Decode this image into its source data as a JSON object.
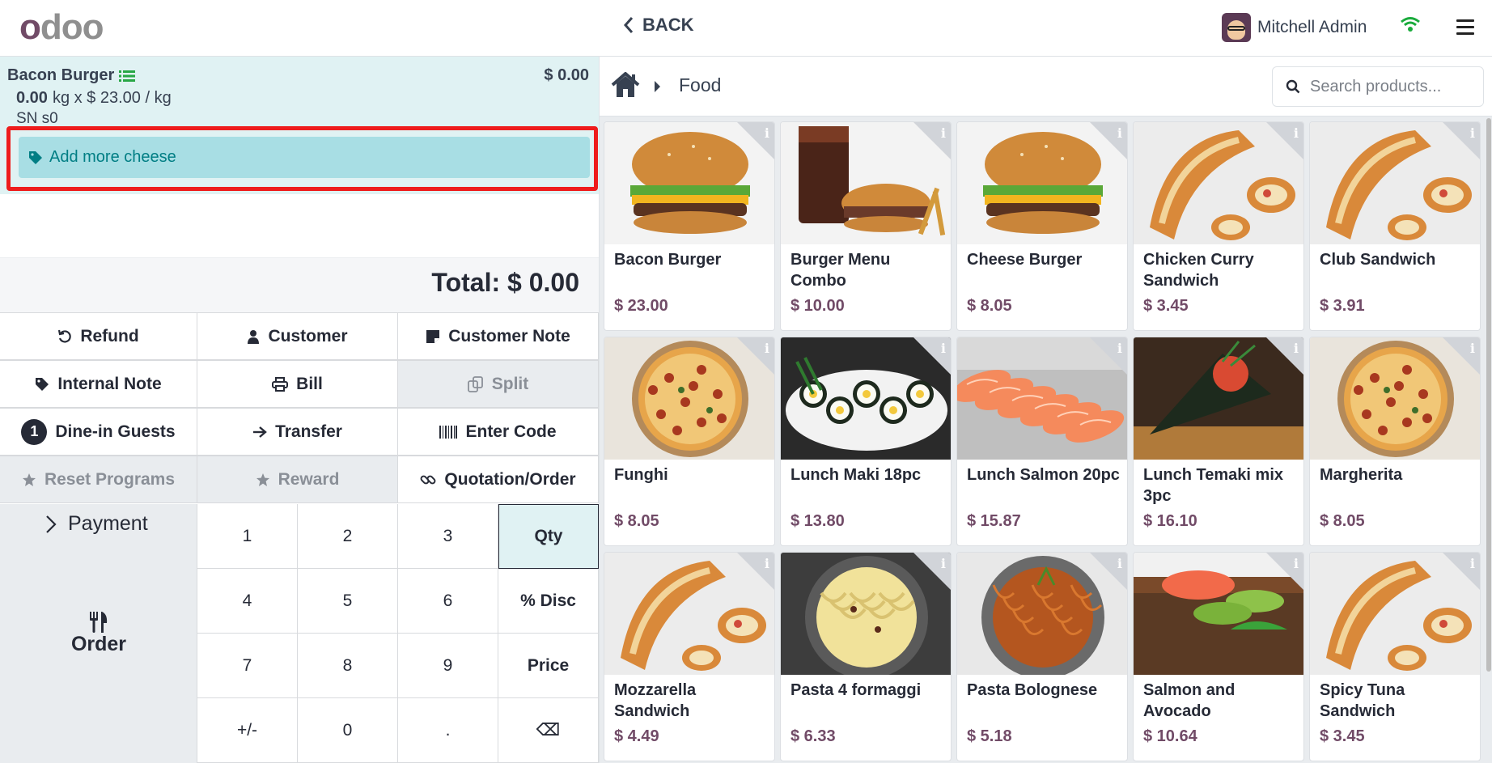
{
  "header": {
    "logo": "odoo",
    "back_label": "BACK",
    "user_name": "Mitchell Admin"
  },
  "order": {
    "line": {
      "product": "Bacon Burger",
      "price": "$ 0.00",
      "qty": "0.00",
      "unit_price": "kg x $ 23.00 / kg",
      "serial": "SN s0",
      "note": "Add more cheese"
    },
    "total": "Total: $ 0.00"
  },
  "controls": {
    "refund": "Refund",
    "customer": "Customer",
    "customer_note": "Customer Note",
    "internal_note": "Internal Note",
    "bill": "Bill",
    "split": "Split",
    "guests_count": "1",
    "dine_in_guests": "Dine-in Guests",
    "transfer": "Transfer",
    "enter_code": "Enter Code",
    "reset_programs": "Reset Programs",
    "reward": "Reward",
    "quotation_order": "Quotation/Order",
    "payment": "Payment",
    "order": "Order"
  },
  "numpad": [
    "1",
    "2",
    "3",
    "Qty",
    "4",
    "5",
    "6",
    "% Disc",
    "7",
    "8",
    "9",
    "Price",
    "+/-",
    "0",
    ".",
    "⌫"
  ],
  "breadcrumb": {
    "category": "Food"
  },
  "search": {
    "placeholder": "Search products..."
  },
  "colors": {
    "brand": "#714b67",
    "selected_line": "#e0f2f3",
    "note_pill": "#a8dee4",
    "highlight_box": "#ee1c1c",
    "wifi": "#1aab3c"
  },
  "products": [
    {
      "name": "Bacon Burger",
      "price": "$ 23.00",
      "image": "burger"
    },
    {
      "name": "Burger Menu Combo",
      "price": "$ 10.00",
      "image": "combo"
    },
    {
      "name": "Cheese Burger",
      "price": "$ 8.05",
      "image": "burger"
    },
    {
      "name": "Chicken Curry Sandwich",
      "price": "$ 3.45",
      "image": "sandwich"
    },
    {
      "name": "Club Sandwich",
      "price": "$ 3.91",
      "image": "sandwich"
    },
    {
      "name": "Funghi",
      "price": "$ 8.05",
      "image": "pizza"
    },
    {
      "name": "Lunch Maki 18pc",
      "price": "$ 13.80",
      "image": "maki"
    },
    {
      "name": "Lunch Salmon 20pc",
      "price": "$ 15.87",
      "image": "salmon"
    },
    {
      "name": "Lunch Temaki mix 3pc",
      "price": "$ 16.10",
      "image": "temaki"
    },
    {
      "name": "Margherita",
      "price": "$ 8.05",
      "image": "pizza"
    },
    {
      "name": "Mozzarella Sandwich",
      "price": "$ 4.49",
      "image": "sandwich"
    },
    {
      "name": "Pasta 4 formaggi",
      "price": "$ 6.33",
      "image": "pasta"
    },
    {
      "name": "Pasta Bolognese",
      "price": "$ 5.18",
      "image": "bolognese"
    },
    {
      "name": "Salmon and Avocado",
      "price": "$ 10.64",
      "image": "avocado"
    },
    {
      "name": "Spicy Tuna Sandwich",
      "price": "$ 3.45",
      "image": "sandwich"
    }
  ]
}
